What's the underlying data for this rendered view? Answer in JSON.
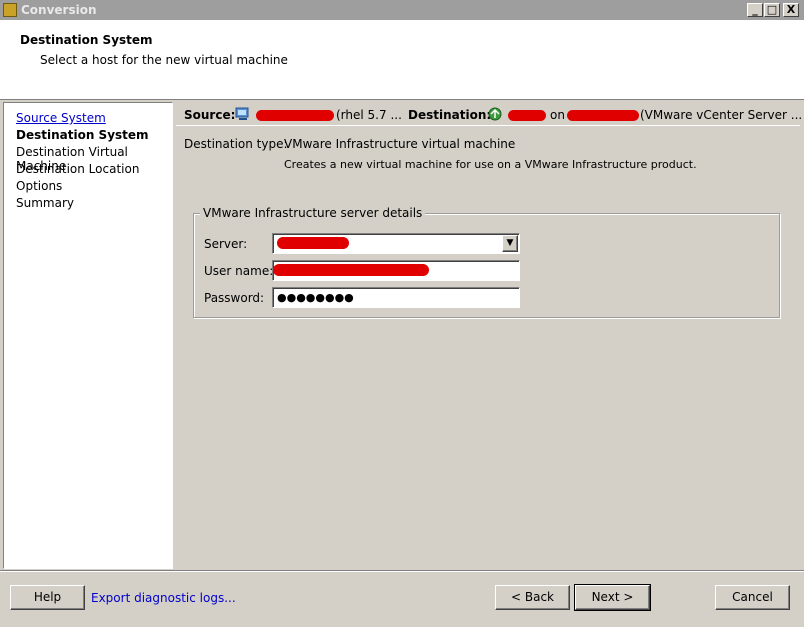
{
  "window": {
    "title": "Conversion",
    "min": "_",
    "max": "□",
    "close": "X"
  },
  "header": {
    "title": "Destination System",
    "subtitle": "Select a host for the new virtual machine"
  },
  "steps": [
    {
      "label": "Source System"
    },
    {
      "label": "Destination System"
    },
    {
      "label": "Destination Virtual Machine"
    },
    {
      "label": "Destination Location"
    },
    {
      "label": "Options"
    },
    {
      "label": "Summary"
    }
  ],
  "info": {
    "source_label": "Source:",
    "source_suffix": "(rhel 5.7 ...",
    "destination_label": "Destination:",
    "destination_on": "on",
    "destination_suffix": "(VMware vCenter Server ..."
  },
  "dest_type": {
    "label": "Destination type:",
    "value": "VMware Infrastructure virtual machine",
    "description": "Creates a new virtual machine for use on a VMware Infrastructure product."
  },
  "server_details": {
    "legend": "VMware Infrastructure server details",
    "server_label": "Server:",
    "username_label": "User name:",
    "password_label": "Password:",
    "password_value": "●●●●●●●●"
  },
  "footer": {
    "help": "Help",
    "export_logs": "Export diagnostic logs...",
    "back": "< Back",
    "next": "Next >",
    "cancel": "Cancel"
  },
  "colors": {
    "redaction": "#e00000",
    "link": "#0000cc",
    "dialog_bg": "#d4d0c8"
  }
}
